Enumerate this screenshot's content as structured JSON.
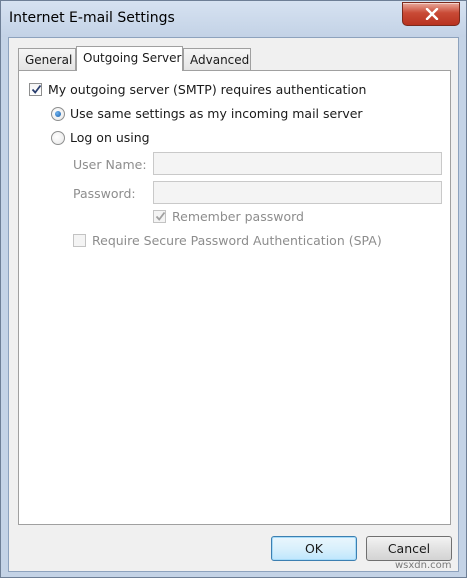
{
  "window": {
    "title": "Internet E-mail Settings"
  },
  "tabs": [
    {
      "label": "General",
      "active": false
    },
    {
      "label": "Outgoing Server",
      "active": true
    },
    {
      "label": "Advanced",
      "active": false
    }
  ],
  "outgoing": {
    "requires_auth": {
      "label": "My outgoing server (SMTP) requires authentication",
      "checked": true
    },
    "auth_options": [
      {
        "label": "Use same settings as my incoming mail server",
        "selected": true
      },
      {
        "label": "Log on using",
        "selected": false
      }
    ],
    "username": {
      "label": "User Name:",
      "value": ""
    },
    "password": {
      "label": "Password:",
      "value": ""
    },
    "remember_password": {
      "label": "Remember password",
      "checked": true,
      "enabled": false
    },
    "spa": {
      "label": "Require Secure Password Authentication (SPA)",
      "checked": false,
      "enabled": false
    }
  },
  "buttons": {
    "ok": "OK",
    "cancel": "Cancel"
  },
  "watermark": "wsxdn.com",
  "colors": {
    "close_button": "#c94a36",
    "radio_dot": "#1a5ea8",
    "default_button_border": "#3c7fb1"
  }
}
